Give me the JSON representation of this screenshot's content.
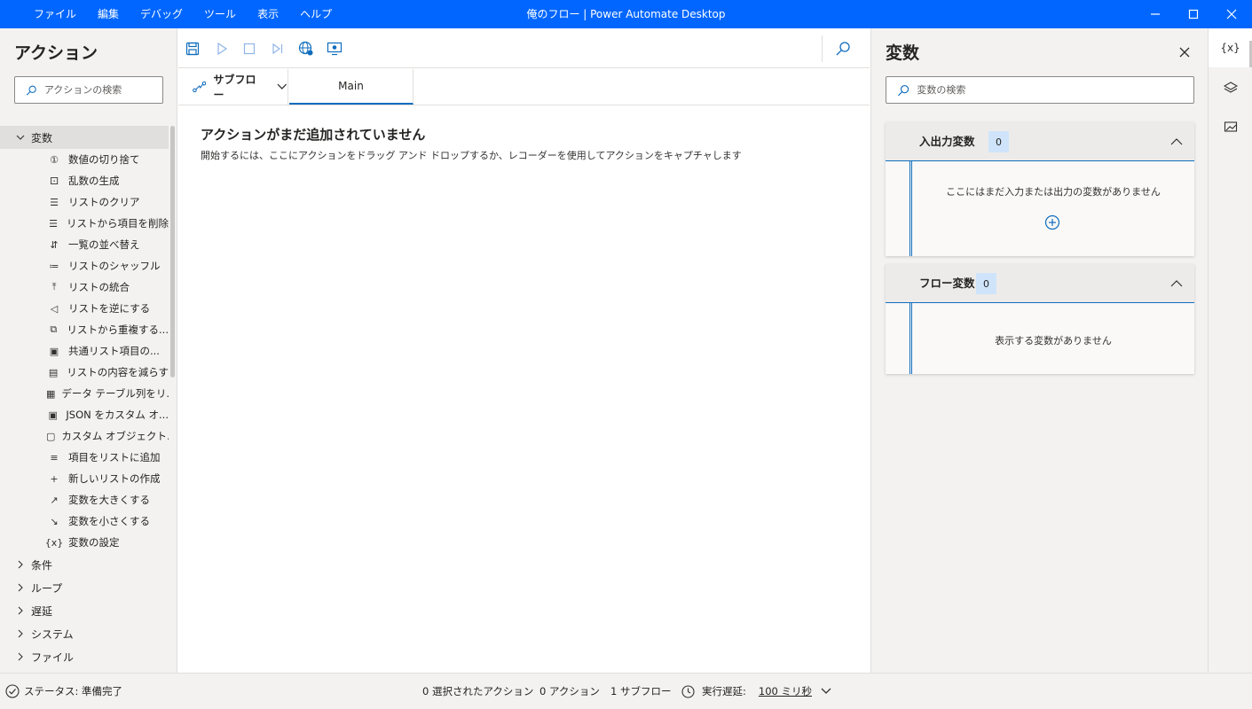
{
  "window": {
    "title": "俺のフロー | Power Automate Desktop",
    "menu": [
      "ファイル",
      "編集",
      "デバッグ",
      "ツール",
      "表示",
      "ヘルプ"
    ]
  },
  "actions_panel": {
    "title": "アクション",
    "search_placeholder": "アクションの検索",
    "expanded_category": {
      "label": "変数",
      "items": [
        {
          "label": "数値の切り捨て",
          "icon": "number-circle-icon"
        },
        {
          "label": "乱数の生成",
          "icon": "random-icon"
        },
        {
          "label": "リストのクリア",
          "icon": "list-clear-icon"
        },
        {
          "label": "リストから項目を削除",
          "icon": "list-remove-icon"
        },
        {
          "label": "一覧の並べ替え",
          "icon": "sort-icon"
        },
        {
          "label": "リストのシャッフル",
          "icon": "shuffle-icon"
        },
        {
          "label": "リストの統合",
          "icon": "merge-icon"
        },
        {
          "label": "リストを逆にする",
          "icon": "reverse-icon"
        },
        {
          "label": "リストから重複する...",
          "icon": "duplicate-icon"
        },
        {
          "label": "共通リスト項目の...",
          "icon": "common-items-icon"
        },
        {
          "label": "リストの内容を減らす",
          "icon": "subtract-icon"
        },
        {
          "label": "データ テーブル列をリ...",
          "icon": "datatable-icon"
        },
        {
          "label": "JSON をカスタム オ...",
          "icon": "json-icon"
        },
        {
          "label": "カスタム オブジェクト...",
          "icon": "js-icon"
        },
        {
          "label": "項目をリストに追加",
          "icon": "list-add-icon"
        },
        {
          "label": "新しいリストの作成",
          "icon": "plus-icon"
        },
        {
          "label": "変数を大きくする",
          "icon": "increase-icon"
        },
        {
          "label": "変数を小さくする",
          "icon": "decrease-icon"
        },
        {
          "label": "変数の設定",
          "icon": "variable-icon"
        }
      ]
    },
    "collapsed_categories": [
      "条件",
      "ループ",
      "遅延",
      "システム",
      "ファイル"
    ]
  },
  "designer": {
    "subflow_label": "サブフロー",
    "main_tab": "Main",
    "empty_title": "アクションがまだ追加されていません",
    "empty_description": "開始するには、ここにアクションをドラッグ アンド ドロップするか、レコーダーを使用してアクションをキャプチャします"
  },
  "variables_panel": {
    "title": "変数",
    "search_placeholder": "変数の検索",
    "io_section": {
      "label": "入出力変数",
      "count": "0",
      "empty_text": "ここにはまだ入力または出力の変数がありません"
    },
    "flow_section": {
      "label": "フロー変数",
      "count": "0",
      "empty_text": "表示する変数がありません"
    }
  },
  "right_rail": {
    "variables_icon_text": "{x}"
  },
  "statusbar": {
    "status": "ステータス: 準備完了",
    "selected_actions": "0 選択されたアクション",
    "actions": "0 アクション",
    "subflows": "1 サブフロー",
    "delay_label": "実行遅延:",
    "delay_value": "100 ミリ秒"
  },
  "colors": {
    "titlebar": "#0066ff",
    "accent": "#0f6cbd",
    "panel_bg": "#f3f2f1"
  }
}
